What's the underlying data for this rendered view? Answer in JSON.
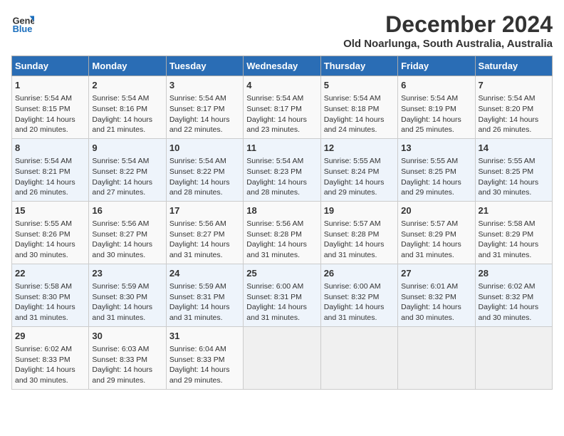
{
  "logo": {
    "line1": "General",
    "line2": "Blue"
  },
  "title": "December 2024",
  "location": "Old Noarlunga, South Australia, Australia",
  "days_of_week": [
    "Sunday",
    "Monday",
    "Tuesday",
    "Wednesday",
    "Thursday",
    "Friday",
    "Saturday"
  ],
  "weeks": [
    [
      {
        "day": "1",
        "sunrise": "5:54 AM",
        "sunset": "8:15 PM",
        "daylight": "14 hours and 20 minutes."
      },
      {
        "day": "2",
        "sunrise": "5:54 AM",
        "sunset": "8:16 PM",
        "daylight": "14 hours and 21 minutes."
      },
      {
        "day": "3",
        "sunrise": "5:54 AM",
        "sunset": "8:17 PM",
        "daylight": "14 hours and 22 minutes."
      },
      {
        "day": "4",
        "sunrise": "5:54 AM",
        "sunset": "8:17 PM",
        "daylight": "14 hours and 23 minutes."
      },
      {
        "day": "5",
        "sunrise": "5:54 AM",
        "sunset": "8:18 PM",
        "daylight": "14 hours and 24 minutes."
      },
      {
        "day": "6",
        "sunrise": "5:54 AM",
        "sunset": "8:19 PM",
        "daylight": "14 hours and 25 minutes."
      },
      {
        "day": "7",
        "sunrise": "5:54 AM",
        "sunset": "8:20 PM",
        "daylight": "14 hours and 26 minutes."
      }
    ],
    [
      {
        "day": "8",
        "sunrise": "5:54 AM",
        "sunset": "8:21 PM",
        "daylight": "14 hours and 26 minutes."
      },
      {
        "day": "9",
        "sunrise": "5:54 AM",
        "sunset": "8:22 PM",
        "daylight": "14 hours and 27 minutes."
      },
      {
        "day": "10",
        "sunrise": "5:54 AM",
        "sunset": "8:22 PM",
        "daylight": "14 hours and 28 minutes."
      },
      {
        "day": "11",
        "sunrise": "5:54 AM",
        "sunset": "8:23 PM",
        "daylight": "14 hours and 28 minutes."
      },
      {
        "day": "12",
        "sunrise": "5:55 AM",
        "sunset": "8:24 PM",
        "daylight": "14 hours and 29 minutes."
      },
      {
        "day": "13",
        "sunrise": "5:55 AM",
        "sunset": "8:25 PM",
        "daylight": "14 hours and 29 minutes."
      },
      {
        "day": "14",
        "sunrise": "5:55 AM",
        "sunset": "8:25 PM",
        "daylight": "14 hours and 30 minutes."
      }
    ],
    [
      {
        "day": "15",
        "sunrise": "5:55 AM",
        "sunset": "8:26 PM",
        "daylight": "14 hours and 30 minutes."
      },
      {
        "day": "16",
        "sunrise": "5:56 AM",
        "sunset": "8:27 PM",
        "daylight": "14 hours and 30 minutes."
      },
      {
        "day": "17",
        "sunrise": "5:56 AM",
        "sunset": "8:27 PM",
        "daylight": "14 hours and 31 minutes."
      },
      {
        "day": "18",
        "sunrise": "5:56 AM",
        "sunset": "8:28 PM",
        "daylight": "14 hours and 31 minutes."
      },
      {
        "day": "19",
        "sunrise": "5:57 AM",
        "sunset": "8:28 PM",
        "daylight": "14 hours and 31 minutes."
      },
      {
        "day": "20",
        "sunrise": "5:57 AM",
        "sunset": "8:29 PM",
        "daylight": "14 hours and 31 minutes."
      },
      {
        "day": "21",
        "sunrise": "5:58 AM",
        "sunset": "8:29 PM",
        "daylight": "14 hours and 31 minutes."
      }
    ],
    [
      {
        "day": "22",
        "sunrise": "5:58 AM",
        "sunset": "8:30 PM",
        "daylight": "14 hours and 31 minutes."
      },
      {
        "day": "23",
        "sunrise": "5:59 AM",
        "sunset": "8:30 PM",
        "daylight": "14 hours and 31 minutes."
      },
      {
        "day": "24",
        "sunrise": "5:59 AM",
        "sunset": "8:31 PM",
        "daylight": "14 hours and 31 minutes."
      },
      {
        "day": "25",
        "sunrise": "6:00 AM",
        "sunset": "8:31 PM",
        "daylight": "14 hours and 31 minutes."
      },
      {
        "day": "26",
        "sunrise": "6:00 AM",
        "sunset": "8:32 PM",
        "daylight": "14 hours and 31 minutes."
      },
      {
        "day": "27",
        "sunrise": "6:01 AM",
        "sunset": "8:32 PM",
        "daylight": "14 hours and 30 minutes."
      },
      {
        "day": "28",
        "sunrise": "6:02 AM",
        "sunset": "8:32 PM",
        "daylight": "14 hours and 30 minutes."
      }
    ],
    [
      {
        "day": "29",
        "sunrise": "6:02 AM",
        "sunset": "8:33 PM",
        "daylight": "14 hours and 30 minutes."
      },
      {
        "day": "30",
        "sunrise": "6:03 AM",
        "sunset": "8:33 PM",
        "daylight": "14 hours and 29 minutes."
      },
      {
        "day": "31",
        "sunrise": "6:04 AM",
        "sunset": "8:33 PM",
        "daylight": "14 hours and 29 minutes."
      },
      null,
      null,
      null,
      null
    ]
  ]
}
